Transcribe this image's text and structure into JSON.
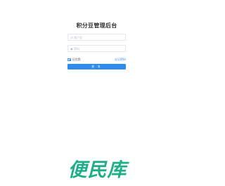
{
  "page": {
    "title": "积分豆管理后台"
  },
  "form": {
    "username_placeholder": "账户名",
    "password_placeholder": "密码",
    "remember_label": "记住我",
    "remember_checked": true,
    "forgot_label": "忘记密码",
    "login_label": "登 录"
  },
  "icons": {
    "username": "user-icon",
    "password": "lock-icon"
  },
  "colors": {
    "primary": "#2d8cf0",
    "title_text": "#333333",
    "logo_green": "#1fae8a"
  },
  "watermark": {
    "text": "便民库"
  }
}
